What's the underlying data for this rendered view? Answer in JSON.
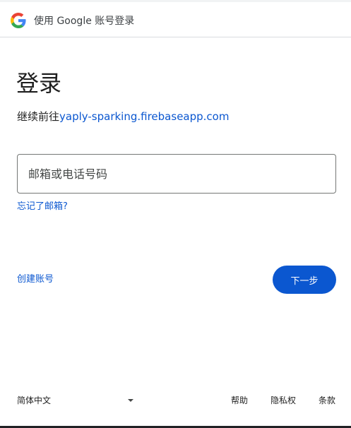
{
  "header": {
    "title": "使用 Google 账号登录"
  },
  "main": {
    "title": "登录",
    "subtitle_prefix": "继续前往",
    "subtitle_link": "yaply-sparking.firebaseapp.com",
    "email_placeholder": "邮箱或电话号码",
    "email_value": "",
    "forgot_label": "忘记了邮箱?",
    "create_account_label": "创建账号",
    "next_label": "下一步"
  },
  "footer": {
    "language": "简体中文",
    "help": "帮助",
    "privacy": "隐私权",
    "terms": "条款"
  },
  "colors": {
    "accent": "#0b57d0",
    "text": "#1f1f1f",
    "border": "#747775"
  }
}
